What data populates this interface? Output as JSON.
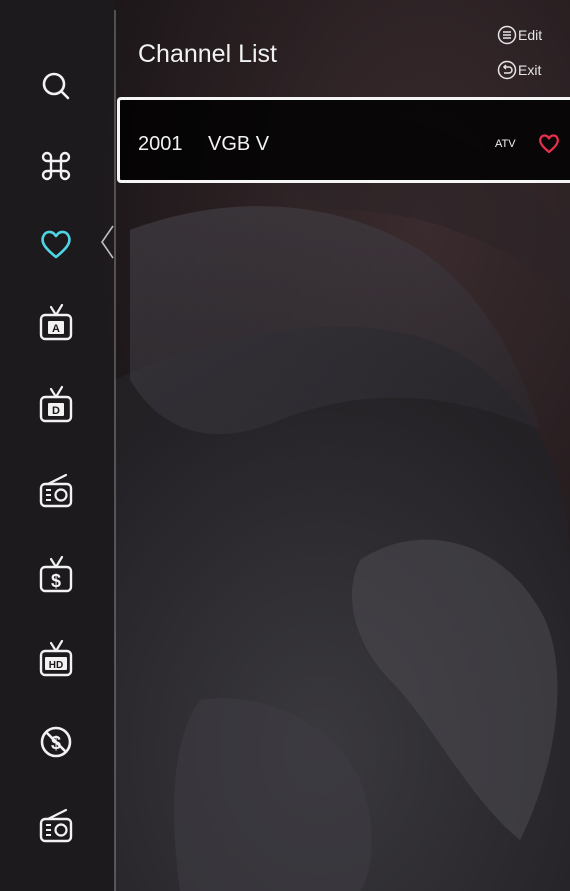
{
  "header": {
    "title": "Channel List",
    "edit_label": "Edit",
    "exit_label": "Exit"
  },
  "sidebar": {
    "items": [
      {
        "name": "search",
        "icon": "search-icon"
      },
      {
        "name": "all-channels",
        "icon": "command-icon"
      },
      {
        "name": "favorites",
        "icon": "heart-icon",
        "active": true
      },
      {
        "name": "analog-tv",
        "icon": "tv-a-icon",
        "glyph": "A"
      },
      {
        "name": "digital-tv",
        "icon": "tv-d-icon",
        "glyph": "D"
      },
      {
        "name": "radio",
        "icon": "radio-icon"
      },
      {
        "name": "pay-tv",
        "icon": "tv-dollar-icon",
        "glyph": "$"
      },
      {
        "name": "hd-tv",
        "icon": "tv-hd-icon",
        "glyph": "HD"
      },
      {
        "name": "free-channels",
        "icon": "no-dollar-icon",
        "glyph": "$"
      },
      {
        "name": "radio-2",
        "icon": "radio-icon"
      }
    ]
  },
  "channels": [
    {
      "number": "2001",
      "name": "VGB V",
      "type": "ATV",
      "favorite": true
    }
  ],
  "colors": {
    "accent_active": "#4fd6e4",
    "favorite": "#e8304c",
    "text": "#f2f2f2"
  }
}
